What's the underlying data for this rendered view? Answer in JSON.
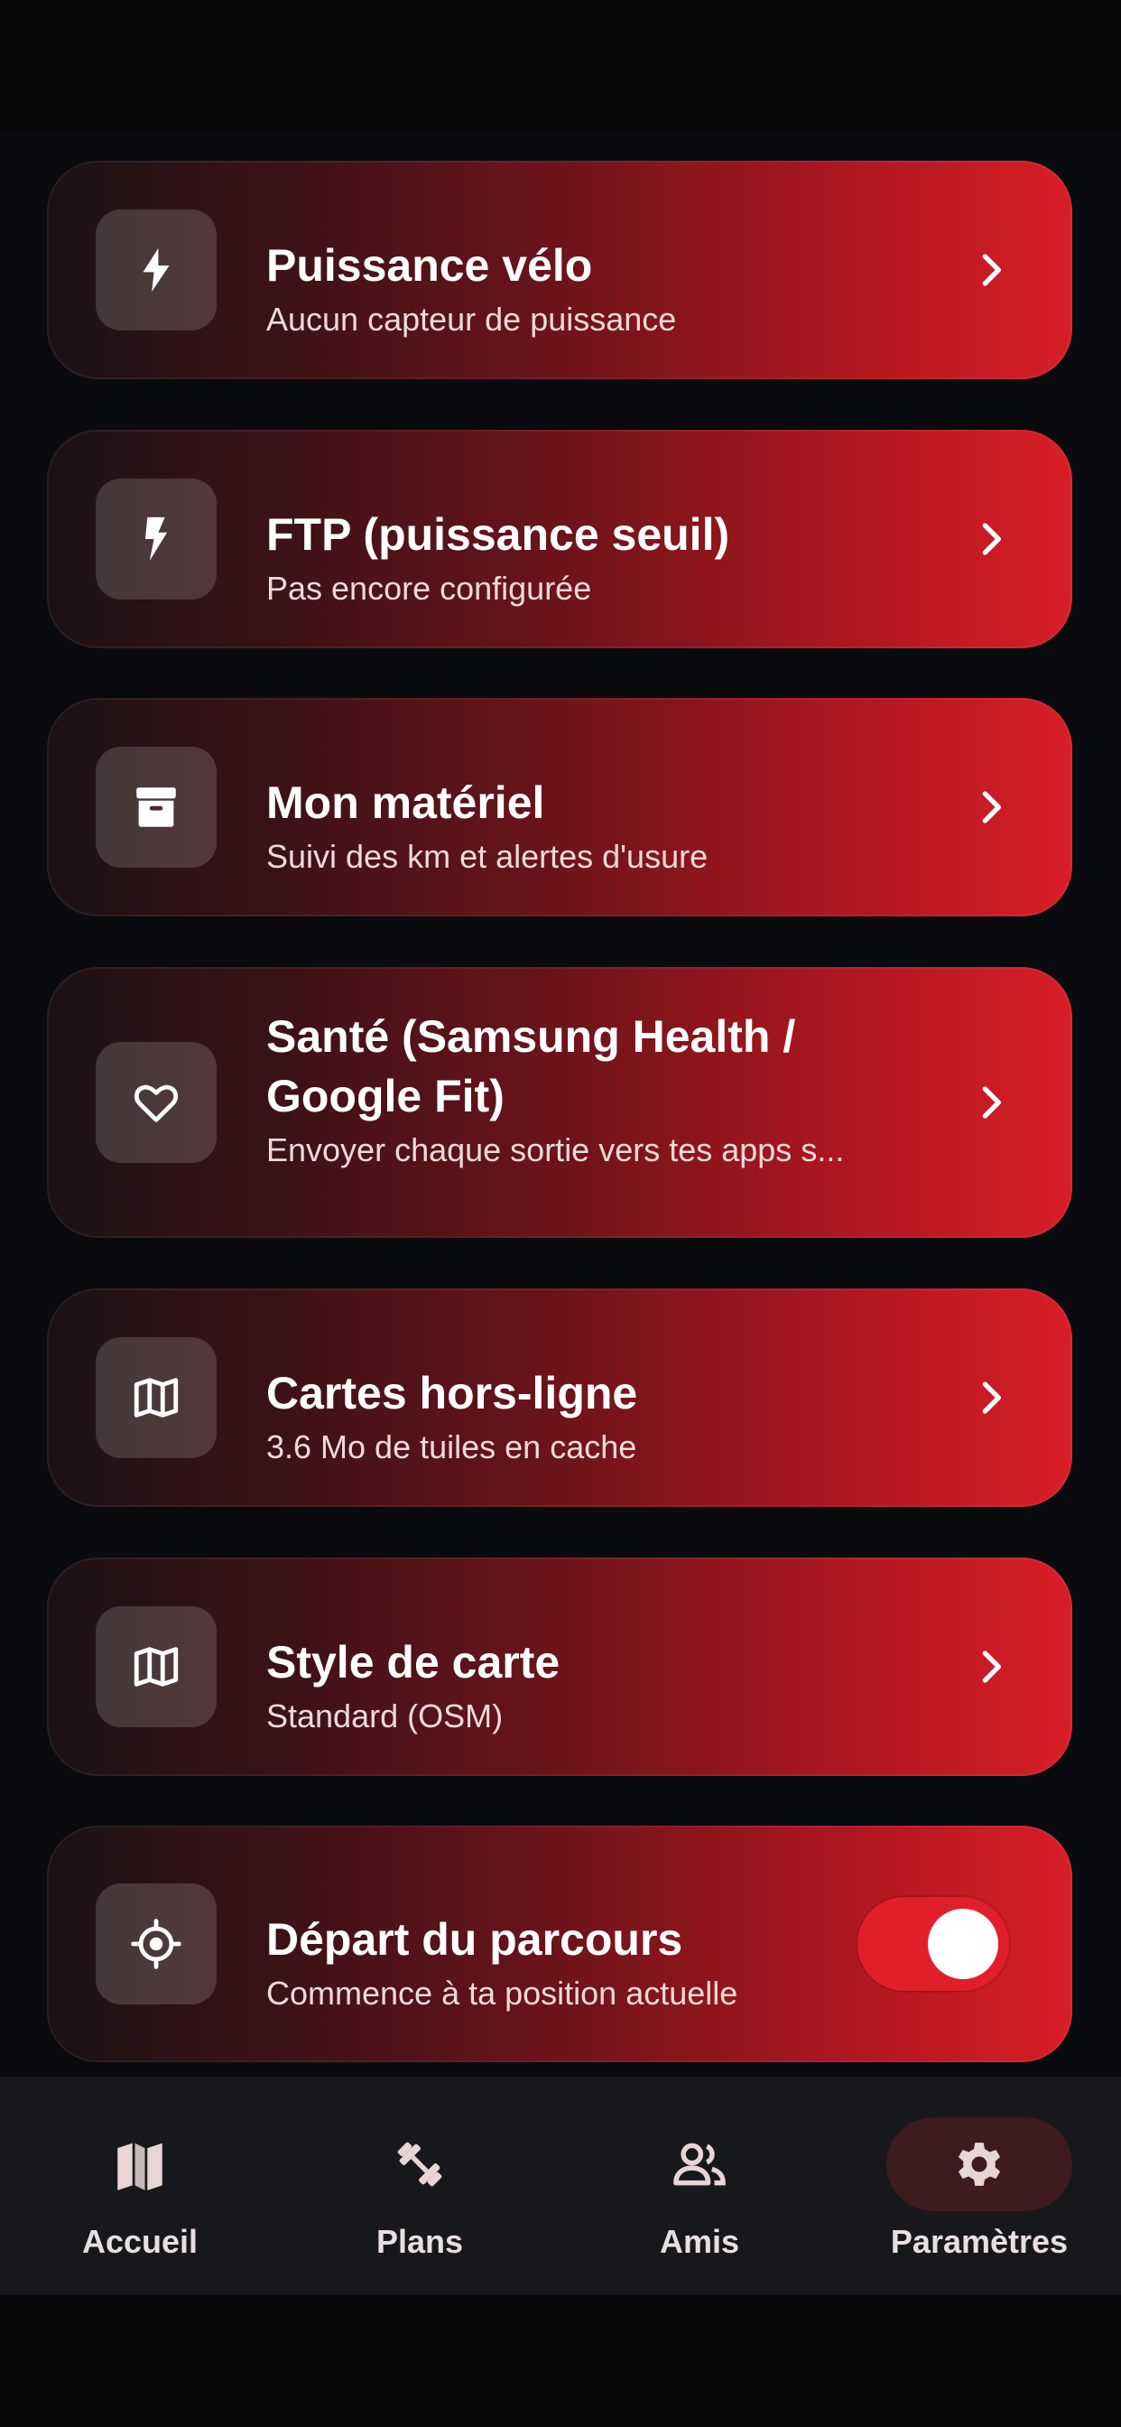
{
  "settings": {
    "items": [
      {
        "title": "Puissance vélo",
        "subtitle": "Aucun capteur de puissance",
        "icon": "bolt-icon",
        "control": "chevron"
      },
      {
        "title": "FTP (puissance seuil)",
        "subtitle": "Pas encore configurée",
        "icon": "flash-icon",
        "control": "chevron"
      },
      {
        "title": "Mon matériel",
        "subtitle": "Suivi des km et alertes d'usure",
        "icon": "inventory-box-icon",
        "control": "chevron"
      },
      {
        "title": "Santé (Samsung Health / Google Fit)",
        "subtitle": "Envoyer chaque sortie vers tes apps s...",
        "icon": "heart-icon",
        "control": "chevron"
      },
      {
        "title": "Cartes hors-ligne",
        "subtitle": "3.6 Mo de tuiles en cache",
        "icon": "map-icon",
        "control": "chevron"
      },
      {
        "title": "Style de carte",
        "subtitle": "Standard (OSM)",
        "icon": "map-icon",
        "control": "chevron"
      },
      {
        "title": "Départ du parcours",
        "subtitle": "Commence à ta position actuelle",
        "icon": "gps-target-icon",
        "control": "toggle",
        "toggle_on": true
      }
    ]
  },
  "nav": {
    "items": [
      {
        "label": "Accueil",
        "icon": "map-icon",
        "active": false
      },
      {
        "label": "Plans",
        "icon": "dumbbell-icon",
        "active": false
      },
      {
        "label": "Amis",
        "icon": "people-icon",
        "active": false
      },
      {
        "label": "Paramètres",
        "icon": "gear-icon",
        "active": true
      }
    ]
  },
  "colors": {
    "background": "#0a0b0e",
    "card_gradient_start": "#1b1215",
    "card_gradient_end": "#d81e28",
    "toggle_on": "#e01f2b",
    "nav_background": "#17181c",
    "nav_active_pill": "#3d1b1e"
  }
}
